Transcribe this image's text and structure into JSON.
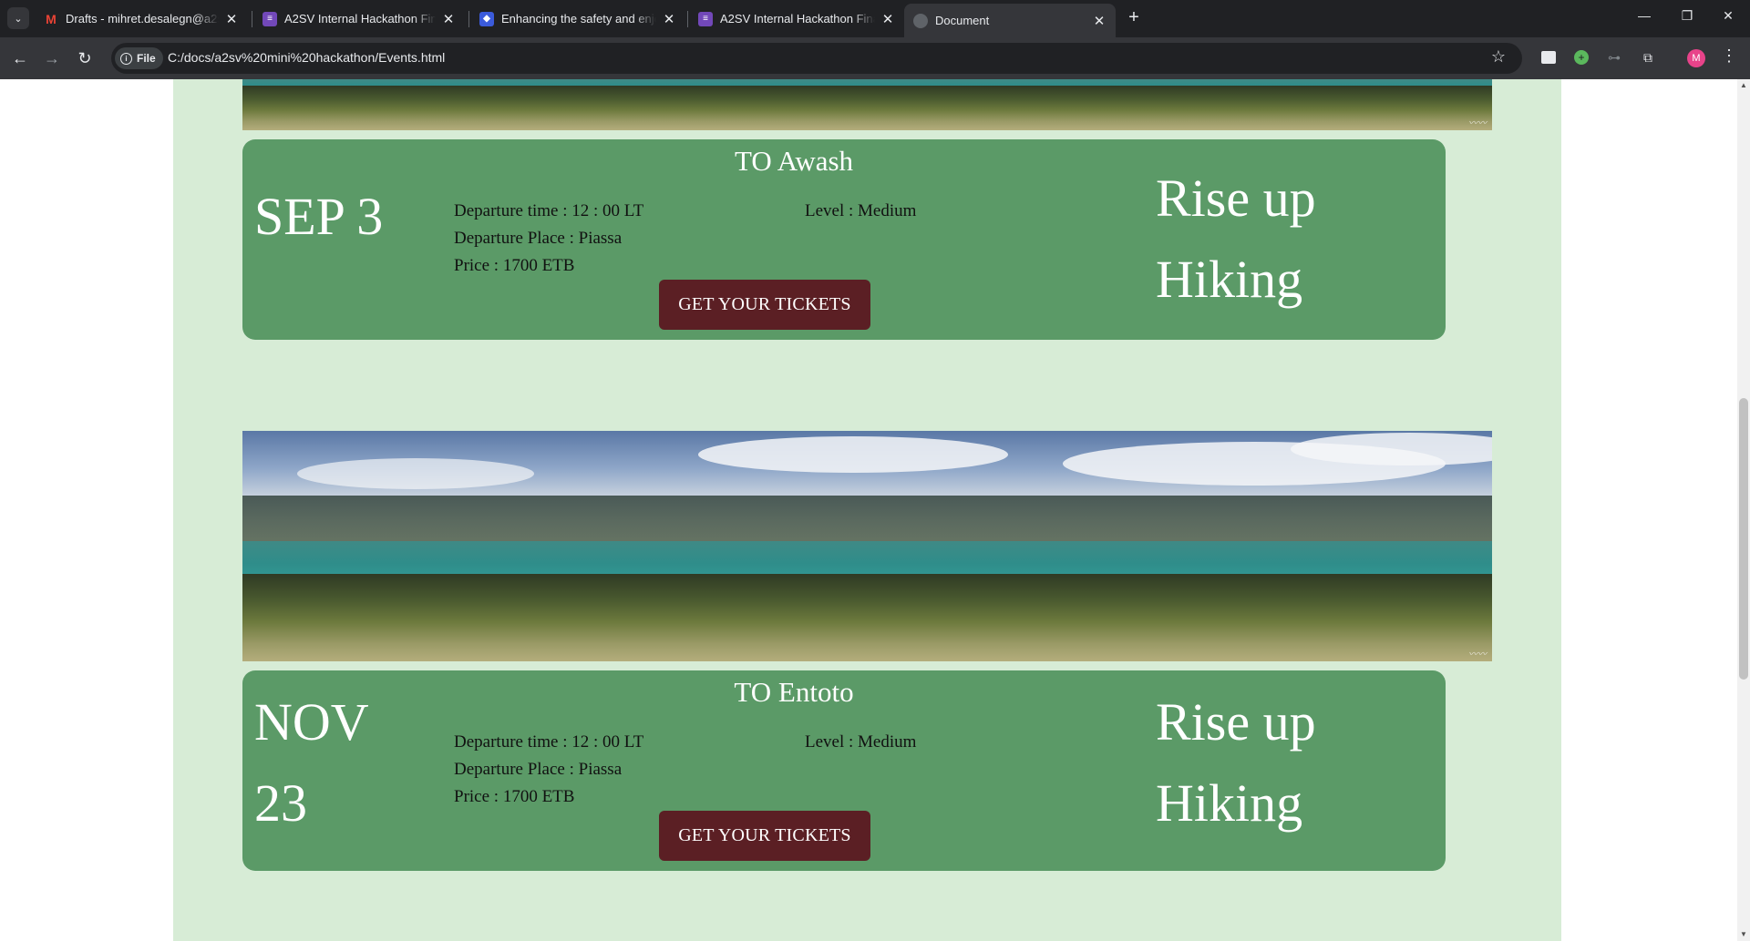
{
  "browser": {
    "tabs": [
      {
        "title": "Drafts - mihret.desalegn@a2sv",
        "icon": "gmail-icon",
        "color": "#ea4335"
      },
      {
        "title": "A2SV Internal Hackathon Final (",
        "icon": "forms-icon",
        "color": "#7248b9"
      },
      {
        "title": "Enhancing the safety and enjoy",
        "icon": "shield-icon",
        "color": "#3b5bdb"
      },
      {
        "title": "A2SV Internal Hackathon Final (",
        "icon": "forms-icon",
        "color": "#7248b9"
      },
      {
        "title": "Document",
        "icon": "globe-icon",
        "color": "#5f6368"
      }
    ],
    "address": {
      "chip_label": "File",
      "url": "C:/docs/a2sv%20mini%20hackathon/Events.html"
    },
    "profile_initial": "M"
  },
  "events": [
    {
      "destination": "TO Awash",
      "date_line1": "SEP 3",
      "date_line2": "",
      "departure_time": "Departure time : 12 : 00 LT",
      "departure_place": "Departure Place : Piassa",
      "price": "Price : 1700 ETB",
      "level": "Level : Medium",
      "tagline_line1": "Rise up",
      "tagline_line2": "Hiking",
      "button_label": "GET YOUR TICKETS"
    },
    {
      "destination": "TO Entoto",
      "date_line1": "NOV",
      "date_line2": "23",
      "departure_time": "Departure time : 12 : 00 LT",
      "departure_place": "Departure Place : Piassa",
      "price": "Price : 1700 ETB",
      "level": "Level : Medium",
      "tagline_line1": "Rise up",
      "tagline_line2": "Hiking",
      "button_label": "GET YOUR TICKETS"
    }
  ],
  "theme": {
    "page_bg": "#d7ecd6",
    "card_bg": "#5b9a67",
    "button_bg": "#5b1f24"
  }
}
